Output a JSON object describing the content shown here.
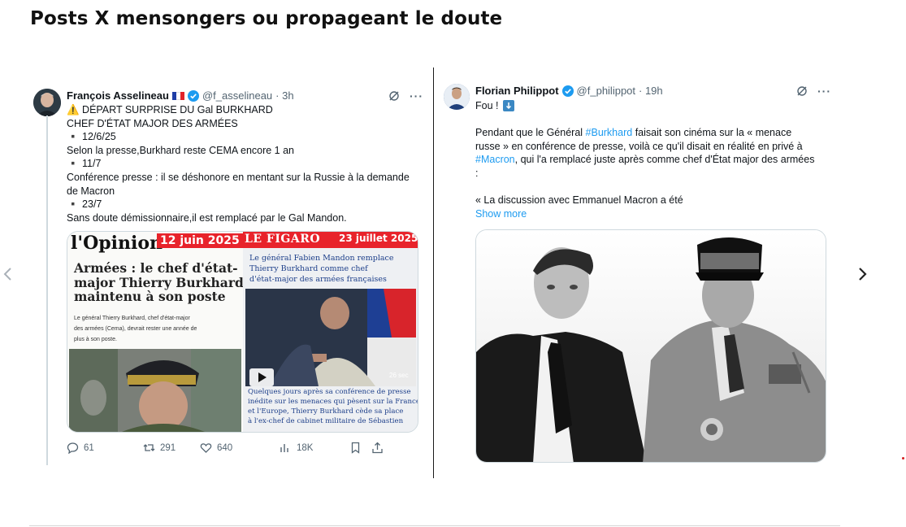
{
  "page_title": "Posts X mensongers ou propageant le doute",
  "tweet_left": {
    "name": "François Asselineau",
    "handle": "@f_asselineau",
    "time": "· 3h",
    "lines": [
      "⚠️ DÉPART SURPRISE DU Gal BURKHARD",
      "CHEF D'ÉTAT MAJOR DES ARMÉES",
      "▪️ 12/6/25",
      "Selon la presse,Burkhard reste CEMA encore 1 an",
      "▪️ 11/7",
      "Conférence presse : il se déshonore en mentant sur la Russie à la demande",
      "de Macron",
      "▪️ 23/7",
      "Sans doute démissionnaire,il est remplacé par le Gal Mandon."
    ],
    "media": {
      "opinion_logo": "l'Opinion",
      "opinion_date": "12 juin 2025",
      "figaro_logo": "LE FIGARO",
      "figaro_date": "23 juillet 2025",
      "opinion_headline": [
        "Armées : le chef d'état-",
        "major Thierry Burkhard",
        "maintenu à son poste"
      ],
      "opinion_sub": [
        "Le général Thierry Burkhard, chef d'état-major",
        "des armées (Cema), devrait rester une année de",
        "plus à son poste."
      ],
      "figaro_headline": [
        "Le général Fabien Mandon remplace",
        "Thierry Burkhard comme chef",
        "d'état-major des armées françaises"
      ],
      "video_duration": "26 sec",
      "figaro_caption": [
        "Quelques jours après sa conférence de presse",
        "inédite sur les menaces qui pèsent sur la France",
        "et l'Europe, Thierry Burkhard cède sa place",
        "à l'ex-chef de cabinet militaire de Sébastien"
      ]
    },
    "stats": {
      "replies": "61",
      "reposts": "291",
      "likes": "640",
      "views": "18K"
    }
  },
  "tweet_right": {
    "name": "Florian Philippot",
    "handle": "@f_philippot",
    "time": "· 19h",
    "first_line": "Fou !",
    "para_1": "Pendant que le Général",
    "hashtag_1": "#Burkhard",
    "para_1_rest": "faisait son cinéma sur la « menace",
    "para_2": "russe » en conférence de presse, voilà ce qu'il disait en réalité en privé à",
    "hashtag_2": "#Macron",
    "para_3_rest": ", qui l'a remplacé juste après comme chef d'État major des armées",
    "para_4": ":",
    "quote": "« La discussion avec Emmanuel Macron a été",
    "show_more": "Show more"
  },
  "icons": {
    "nav_prev": "chevron-left-icon",
    "nav_next": "chevron-right-icon",
    "grok": "grok-icon",
    "more": "more-icon",
    "reply": "reply-icon",
    "repost": "repost-icon",
    "like": "heart-icon",
    "views": "views-icon",
    "bookmark": "bookmark-icon",
    "share": "share-icon"
  },
  "colors": {
    "accent_blue": "#1d9bf0",
    "opinion_red": "#e8232b",
    "figaro_red": "#e8232b"
  }
}
